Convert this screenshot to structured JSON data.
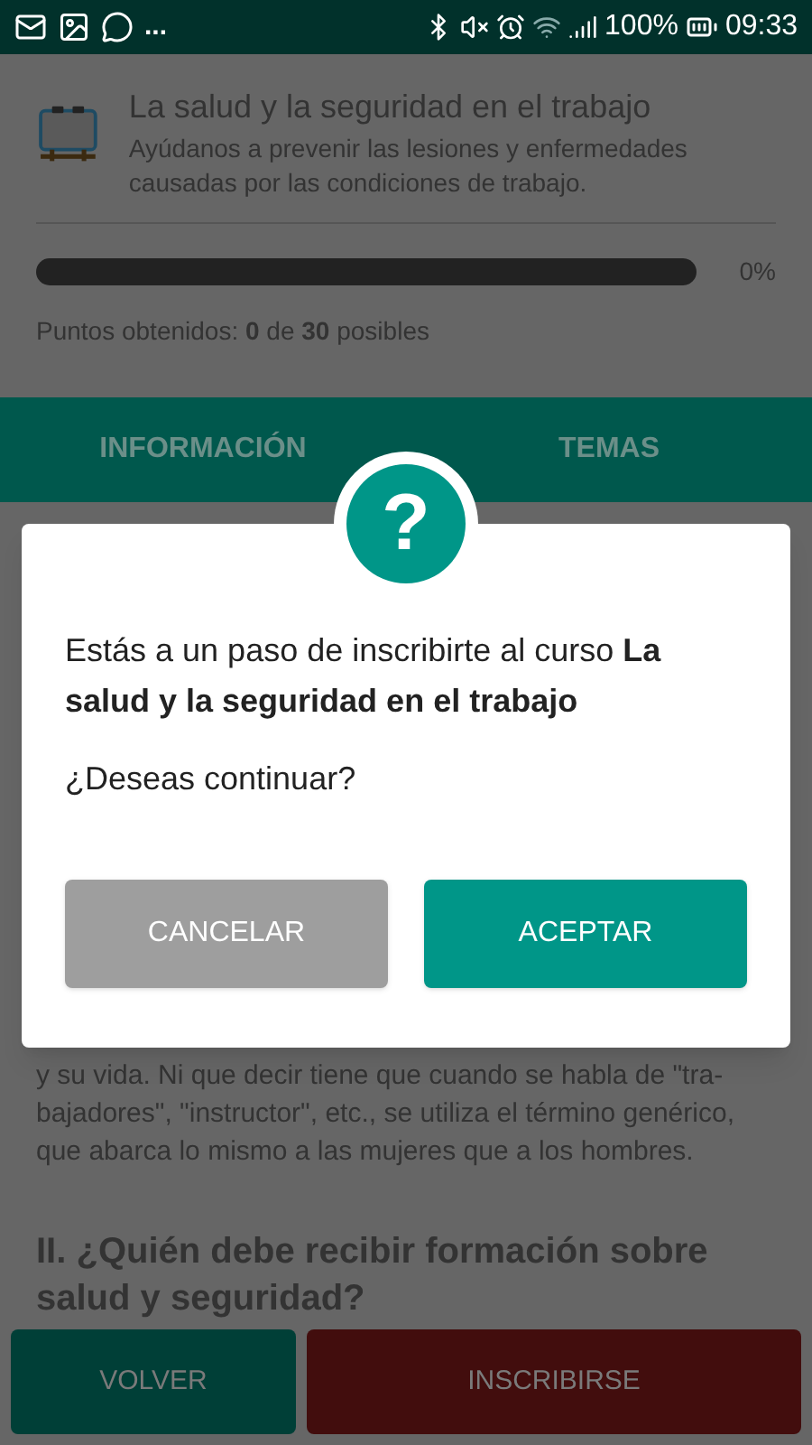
{
  "status_bar": {
    "more": "...",
    "battery": "100%",
    "time": "09:33"
  },
  "course": {
    "title": "La salud y la seguridad en el trabajo",
    "description": "Ayúdanos a prevenir las lesiones y enfermedades causadas por las condiciones de trabajo.",
    "progress": {
      "level": 0,
      "reading": "0%"
    },
    "points": "Puntos obtenidos: **0** de **30** posibles"
  },
  "tabs": [
    {
      "label": "INFORMACIÓN"
    },
    {
      "label": "TEMAS"
    }
  ],
  "content": {
    "paragraph": "y su vida. Ni que decir tiene que cuando se habla de \"tra-bajadores\", \"instructor\", etc., se utiliza el término genérico, que abarca lo mismo a las mujeres que a los hombres.",
    "heading": "II. ¿Quién debe recibir formación sobre salud y seguridad?"
  },
  "dialog": {
    "icon": "?",
    "message": "Estás a un paso de inscribirte al curso **La salud y la seguridad en el trabajo**",
    "question": "¿Deseas continuar?",
    "buttons": [
      {
        "label": "CANCELAR",
        "kind": "secondary"
      },
      {
        "label": "ACEPTAR",
        "kind": "primary"
      }
    ]
  },
  "bottom_buttons": [
    {
      "label": "VOLVER",
      "kind": "back"
    },
    {
      "label": "INSCRIBIRSE",
      "kind": "enroll"
    }
  ]
}
